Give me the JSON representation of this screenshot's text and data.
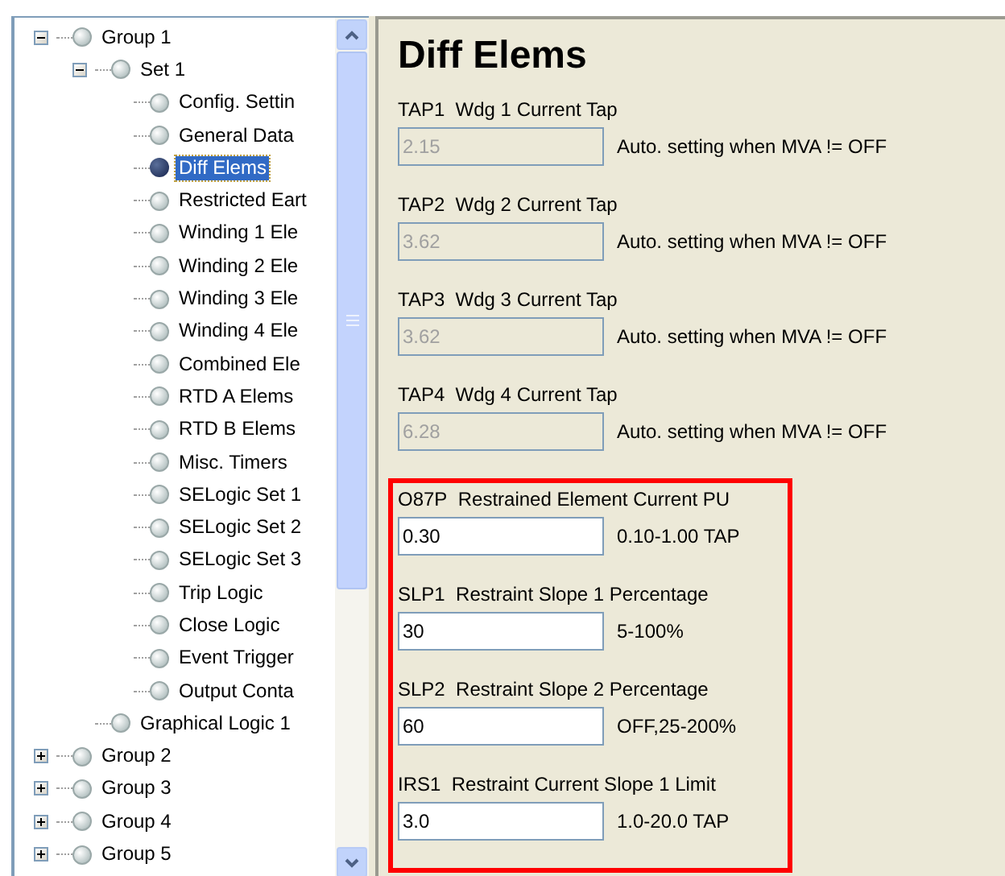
{
  "tree": [
    {
      "label": "Group 1",
      "expanded": true,
      "selected": false,
      "children": [
        {
          "label": "Set 1",
          "expanded": true,
          "selected": false,
          "children": [
            {
              "label": "Config. Settin",
              "selected": false
            },
            {
              "label": "General Data",
              "selected": false
            },
            {
              "label": "Diff Elems",
              "selected": true
            },
            {
              "label": "Restricted Eart",
              "selected": false
            },
            {
              "label": "Winding 1 Ele",
              "selected": false
            },
            {
              "label": "Winding 2 Ele",
              "selected": false
            },
            {
              "label": "Winding 3 Ele",
              "selected": false
            },
            {
              "label": "Winding 4 Ele",
              "selected": false
            },
            {
              "label": "Combined Ele",
              "selected": false
            },
            {
              "label": "RTD A Elems",
              "selected": false
            },
            {
              "label": "RTD B Elems",
              "selected": false
            },
            {
              "label": "Misc. Timers",
              "selected": false
            },
            {
              "label": "SELogic Set 1",
              "selected": false
            },
            {
              "label": "SELogic Set 2",
              "selected": false
            },
            {
              "label": "SELogic Set 3",
              "selected": false
            },
            {
              "label": "Trip Logic",
              "selected": false
            },
            {
              "label": "Close Logic",
              "selected": false
            },
            {
              "label": "Event Trigger",
              "selected": false
            },
            {
              "label": "Output Conta",
              "selected": false
            }
          ]
        },
        {
          "label": "Graphical Logic 1",
          "selected": false
        }
      ]
    },
    {
      "label": "Group 2",
      "expanded": false,
      "selected": false
    },
    {
      "label": "Group 3",
      "expanded": false,
      "selected": false
    },
    {
      "label": "Group 4",
      "expanded": false,
      "selected": false
    },
    {
      "label": "Group 5",
      "expanded": false,
      "selected": false
    }
  ],
  "page": {
    "title": "Diff Elems",
    "sections": [
      {
        "highlighted": false,
        "settings": [
          {
            "code": "TAP1",
            "label": "Wdg 1 Current Tap",
            "value": "2.15",
            "disabled": true,
            "range": "Auto. setting when MVA != OFF"
          },
          {
            "code": "TAP2",
            "label": "Wdg 2 Current Tap",
            "value": "3.62",
            "disabled": true,
            "range": "Auto. setting when MVA != OFF"
          },
          {
            "code": "TAP3",
            "label": "Wdg 3 Current Tap",
            "value": "3.62",
            "disabled": true,
            "range": "Auto. setting when MVA != OFF"
          },
          {
            "code": "TAP4",
            "label": "Wdg 4 Current Tap",
            "value": "6.28",
            "disabled": true,
            "range": "Auto. setting when MVA != OFF"
          }
        ]
      },
      {
        "highlighted": true,
        "settings": [
          {
            "code": "O87P",
            "label": "Restrained Element Current PU",
            "value": "0.30",
            "disabled": false,
            "range": "0.10-1.00 TAP"
          },
          {
            "code": "SLP1",
            "label": "Restraint Slope 1 Percentage",
            "value": "30",
            "disabled": false,
            "range": "5-100%"
          },
          {
            "code": "SLP2",
            "label": "Restraint Slope 2 Percentage",
            "value": "60",
            "disabled": false,
            "range": "OFF,25-200%"
          },
          {
            "code": "IRS1",
            "label": "Restraint Current Slope 1 Limit",
            "value": "3.0",
            "disabled": false,
            "range": "1.0-20.0 TAP"
          }
        ]
      }
    ]
  }
}
